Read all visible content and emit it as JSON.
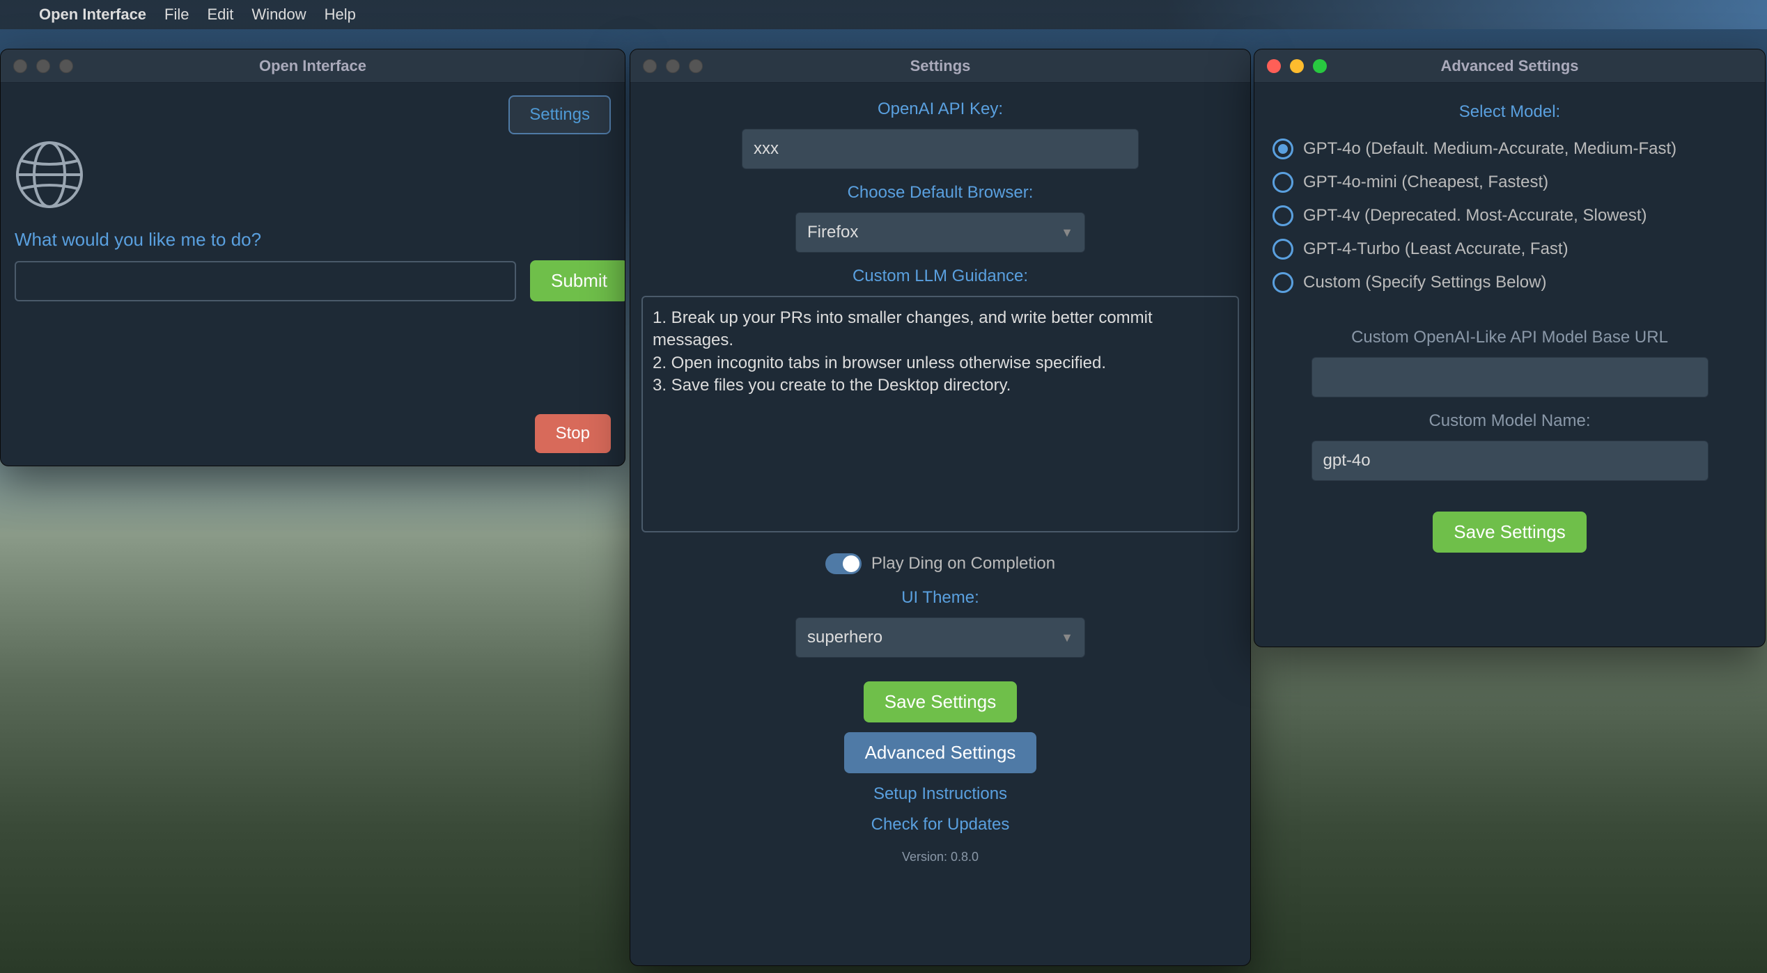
{
  "menubar": {
    "app": "Open Interface",
    "items": [
      "File",
      "Edit",
      "Window",
      "Help"
    ]
  },
  "main": {
    "title": "Open Interface",
    "settings_btn": "Settings",
    "prompt_label": "What would you like me to do?",
    "input_value": "",
    "submit": "Submit",
    "stop": "Stop"
  },
  "settings": {
    "title": "Settings",
    "api_key_label": "OpenAI API Key:",
    "api_key_value": "xxx",
    "browser_label": "Choose Default Browser:",
    "browser_value": "Firefox",
    "llm_label": "Custom LLM Guidance:",
    "llm_value": "1. Break up your PRs into smaller changes, and write better commit messages.\n2. Open incognito tabs in browser unless otherwise specified.\n3. Save files you create to the Desktop directory.",
    "ding_label": "Play Ding on Completion",
    "theme_label": "UI Theme:",
    "theme_value": "superhero",
    "save": "Save Settings",
    "advanced": "Advanced Settings",
    "setup_link": "Setup Instructions",
    "update_link": "Check for Updates",
    "version": "Version: 0.8.0"
  },
  "advanced": {
    "title": "Advanced Settings",
    "select_model_label": "Select Model:",
    "models": [
      "GPT-4o (Default. Medium-Accurate, Medium-Fast)",
      "GPT-4o-mini (Cheapest, Fastest)",
      "GPT-4v (Deprecated. Most-Accurate, Slowest)",
      "GPT-4-Turbo (Least Accurate, Fast)",
      "Custom (Specify Settings Below)"
    ],
    "selected_model_index": 0,
    "base_url_label": "Custom OpenAI-Like API Model Base URL",
    "base_url_value": "",
    "model_name_label": "Custom Model Name:",
    "model_name_value": "gpt-4o",
    "save": "Save Settings"
  }
}
